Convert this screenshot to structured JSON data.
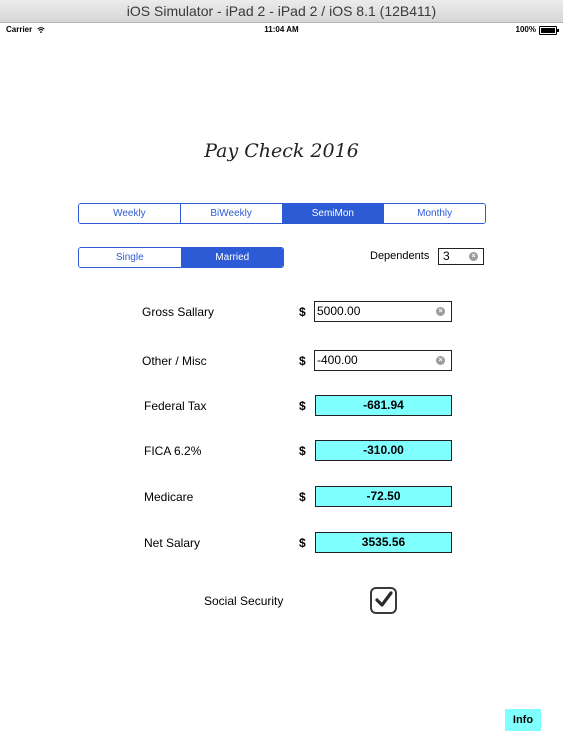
{
  "window": {
    "title": "iOS Simulator - iPad 2 - iPad 2 / iOS 8.1 (12B411)"
  },
  "status_bar": {
    "carrier": "Carrier",
    "time": "11:04 AM",
    "battery": "100%"
  },
  "app": {
    "title": "Pay Check 2016"
  },
  "period_segments": {
    "items": [
      "Weekly",
      "BiWeekly",
      "SemiMon",
      "Monthly"
    ],
    "selected": "SemiMon"
  },
  "status_segments": {
    "items": [
      "Single",
      "Married"
    ],
    "selected": "Married"
  },
  "dependents": {
    "label": "Dependents",
    "value": "3"
  },
  "rows": {
    "gross": {
      "label": "Gross Sallary",
      "currency": "$",
      "value": "5000.00"
    },
    "other": {
      "label": "Other / Misc",
      "currency": "$",
      "value": "-400.00"
    },
    "federal": {
      "label": "Federal Tax",
      "currency": "$",
      "value": "-681.94"
    },
    "fica": {
      "label": "FICA 6.2%",
      "currency": "$",
      "value": "-310.00"
    },
    "medicare": {
      "label": "Medicare",
      "currency": "$",
      "value": "-72.50"
    },
    "net": {
      "label": "Net Salary",
      "currency": "$",
      "value": "3535.56"
    }
  },
  "social_security": {
    "label": "Social Security",
    "checked": true
  },
  "info_button": {
    "label": "Info"
  },
  "colors": {
    "accent": "#2d5bd6",
    "output_bg": "#80ffff"
  }
}
